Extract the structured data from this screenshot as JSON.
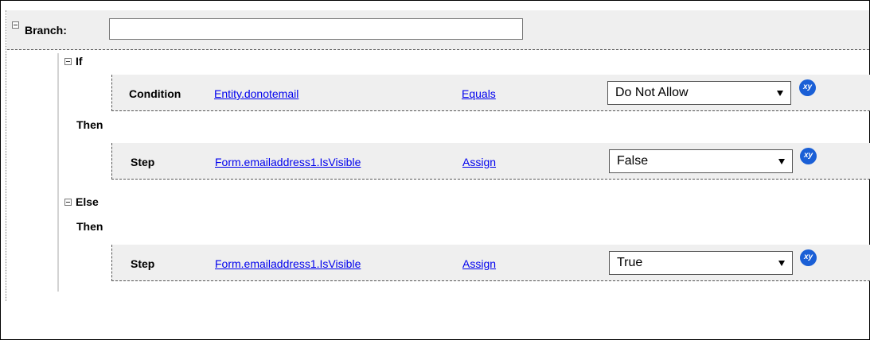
{
  "branch": {
    "label": "Branch:",
    "input_value": ""
  },
  "if_block": {
    "label": "If",
    "condition": {
      "label": "Condition",
      "field": "Entity.donotemail",
      "operator": "Equals",
      "value": "Do Not Allow"
    },
    "then_label": "Then",
    "step": {
      "label": "Step",
      "field": "Form.emailaddress1.IsVisible",
      "operator": "Assign",
      "value": "False"
    }
  },
  "else_block": {
    "label": "Else",
    "then_label": "Then",
    "step": {
      "label": "Step",
      "field": "Form.emailaddress1.IsVisible",
      "operator": "Assign",
      "value": "True"
    }
  },
  "xy_button_label": "xy"
}
